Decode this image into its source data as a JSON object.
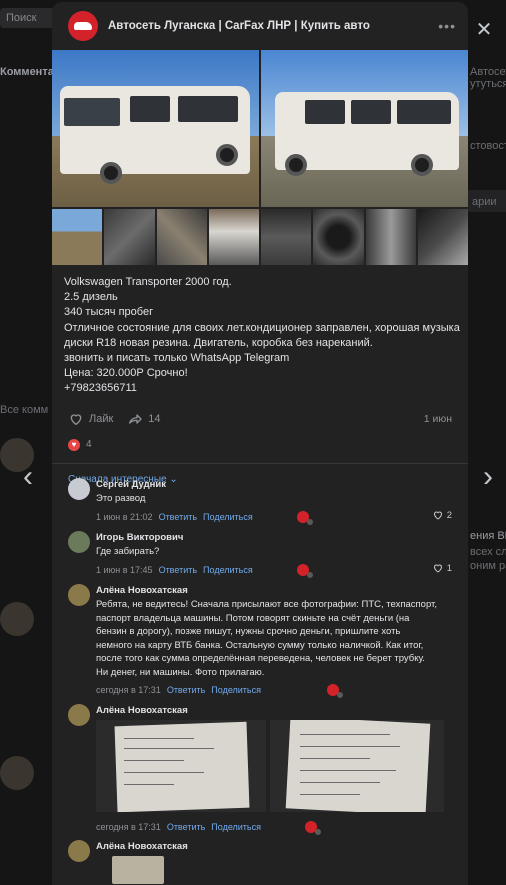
{
  "background": {
    "search_label": "Поиск",
    "left_texts": [
      "Коммента",
      "Все комм"
    ],
    "right_texts": [
      "Автосеть Л",
      "утуться из",
      "стовости",
      "арии",
      "ения ВКонт",
      "всех сл",
      "оним разд"
    ],
    "colors": {
      "page": "#151516"
    }
  },
  "close_icon": "✕",
  "nav": {
    "prev_icon": "‹",
    "next_icon": "›"
  },
  "post": {
    "group_name": "Автосеть Луганска | CarFax ЛНР | Купить авто",
    "more_icon": "•••",
    "text_lines": [
      "Volkswagen Transporter 2000 год.",
      "2.5 дизель",
      "340 тысяч пробег",
      "Отличное состояние для своих лет.кондиционер заправлен, хорошая музыка",
      "диски R18 новая резина. Двигатель, коробка без нареканий.",
      "звонить и писать только WhatsApp Telegram",
      "Цена: 320.000Р Срочно!",
      "+79823656711"
    ],
    "like_label": "Лайк",
    "share_count": "14",
    "date": "1 июн",
    "reactions_count": "4",
    "sort_label": "Сначала интересные ⌄"
  },
  "comments": [
    {
      "author": "Сергей Дудник",
      "text": [
        "Это развод"
      ],
      "time": "1 июн в 21:02",
      "reply": "Ответить",
      "share": "Поделиться",
      "likes": "2"
    },
    {
      "author": "Игорь Викторович",
      "text": [
        "Где забирать?"
      ],
      "time": "1 июн в 17:45",
      "reply": "Ответить",
      "share": "Поделиться",
      "likes": "1"
    },
    {
      "author": "Алёна Новохатская",
      "text": [
        "Ребята, не ведитесь! Сначала присылают все фотографии: ПТС, техпаспорт,",
        "паспорт владельца машины. Потом говорят скиньте на счёт деньги (на",
        "бензин в дорогу), позже пишут, нужны срочно деньги, пришлите хоть",
        "немного на карту ВТБ банка. Остальную сумму только наличкой. Как итог,",
        "после того как сумма определённая переведена, человек не берет трубку.",
        "Ни денег, ни машины. Фото прилагаю."
      ],
      "time": "сегодня в 17:31",
      "reply": "Ответить",
      "share": "Поделиться"
    },
    {
      "author": "Алёна Новохатская",
      "text": [],
      "time": "сегодня в 17:31",
      "reply": "Ответить",
      "share": "Поделиться"
    },
    {
      "author": "Алёна Новохатская",
      "text": [],
      "time": "",
      "reply": "",
      "share": ""
    }
  ],
  "colors": {
    "link": "#71aaeb",
    "modal": "#222222",
    "brand_red": "#d3222a"
  }
}
